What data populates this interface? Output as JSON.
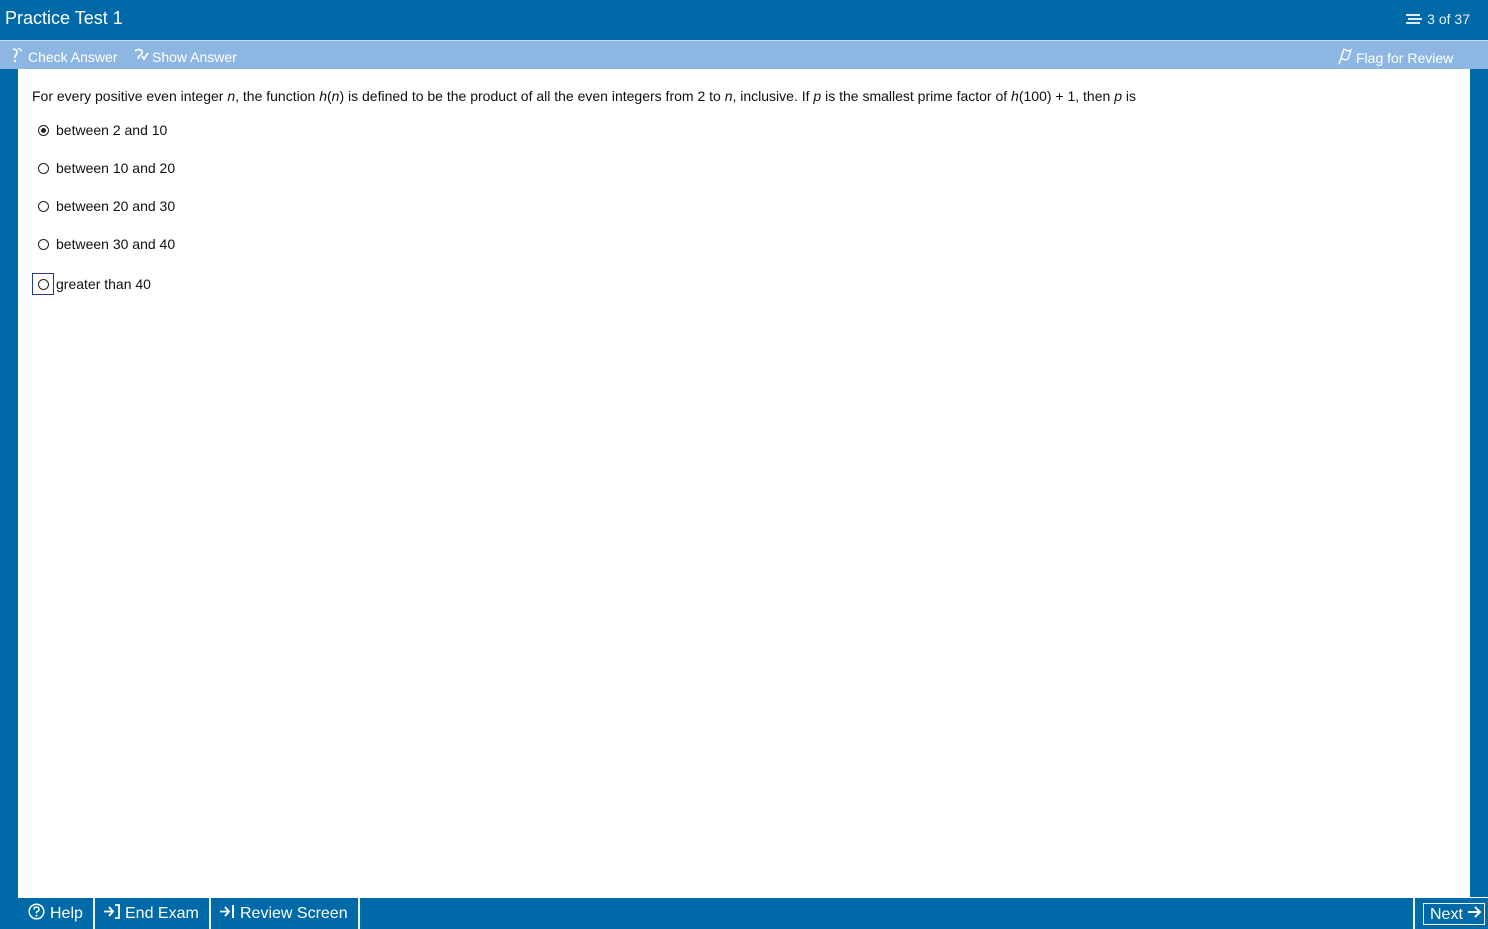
{
  "window": {
    "title": "Practice Test 1",
    "question_counter": "3 of 37"
  },
  "toolbar": {
    "check_answer": "Check Answer",
    "show_answer": "Show Answer",
    "flag_for_review": "Flag for Review"
  },
  "question": {
    "part1": "For every positive even integer ",
    "var_n1": "n",
    "part2": ", the function ",
    "var_h1": "h",
    "part3": "(",
    "var_n2": "n",
    "part4": ") is defined to be the product of all the even integers from 2 to ",
    "var_n3": "n",
    "part5": ", inclusive.  If ",
    "var_p1": "p",
    "part6": " is the smallest prime factor of ",
    "var_h2": "h",
    "part7": "(100) + 1, then ",
    "var_p2": "p",
    "part8": " is"
  },
  "choices": [
    {
      "label": "between 2 and 10",
      "selected": true
    },
    {
      "label": "between 10 and 20",
      "selected": false
    },
    {
      "label": "between 20 and 30",
      "selected": false
    },
    {
      "label": "between 30 and 40",
      "selected": false
    },
    {
      "label": "greater than 40",
      "selected": false
    }
  ],
  "footer": {
    "help": "Help",
    "end_exam": "End Exam",
    "review_screen": "Review Screen",
    "next": "Next"
  },
  "icons": {
    "counter": "question-list-icon",
    "check": "check-answer-icon",
    "show": "show-answer-icon",
    "flag": "flag-icon",
    "help": "help-circle-icon",
    "end": "end-exam-icon",
    "review": "review-screen-icon",
    "next": "arrow-right-icon"
  },
  "colors": {
    "header_blue": "#0069a8",
    "toolbar_blue": "#8db7e2"
  }
}
